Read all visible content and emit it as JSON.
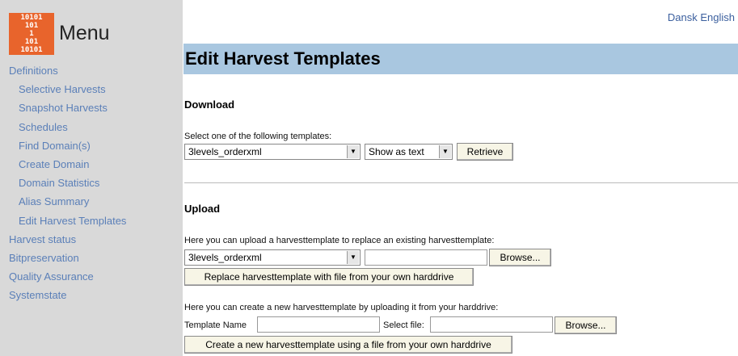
{
  "sidebar": {
    "logo_lines": [
      "10101",
      "101",
      "1",
      "101",
      "10101"
    ],
    "title": "Menu",
    "items": [
      {
        "label": "Definitions"
      },
      {
        "label": "Selective Harvests"
      },
      {
        "label": "Snapshot Harvests"
      },
      {
        "label": "Schedules"
      },
      {
        "label": "Find Domain(s)"
      },
      {
        "label": "Create Domain"
      },
      {
        "label": "Domain Statistics"
      },
      {
        "label": "Alias Summary"
      },
      {
        "label": "Edit Harvest Templates"
      },
      {
        "label": "Harvest status"
      },
      {
        "label": "Bitpreservation"
      },
      {
        "label": "Quality Assurance"
      },
      {
        "label": "Systemstate"
      }
    ]
  },
  "lang": {
    "dansk": "Dansk",
    "english": "English"
  },
  "page": {
    "title": "Edit Harvest Templates"
  },
  "download": {
    "heading": "Download",
    "instruction": "Select one of the following templates:",
    "template_value": "3levels_orderxml",
    "format_value": "Show as text",
    "retrieve_label": "Retrieve"
  },
  "upload": {
    "heading": "Upload",
    "replace_instruction": "Here you can upload a harvesttemplate to replace an existing harvesttemplate:",
    "replace_template_value": "3levels_orderxml",
    "browse_label": "Browse...",
    "replace_button": "Replace harvesttemplate with file from your own harddrive",
    "create_instruction": "Here you can create a new harvesttemplate by uploading it from your harddrive:",
    "template_name_label": "Template Name",
    "select_file_label": "Select file:",
    "browse_label_2": "Browse...",
    "create_button": "Create a new harvesttemplate using a file from your own harddrive"
  }
}
